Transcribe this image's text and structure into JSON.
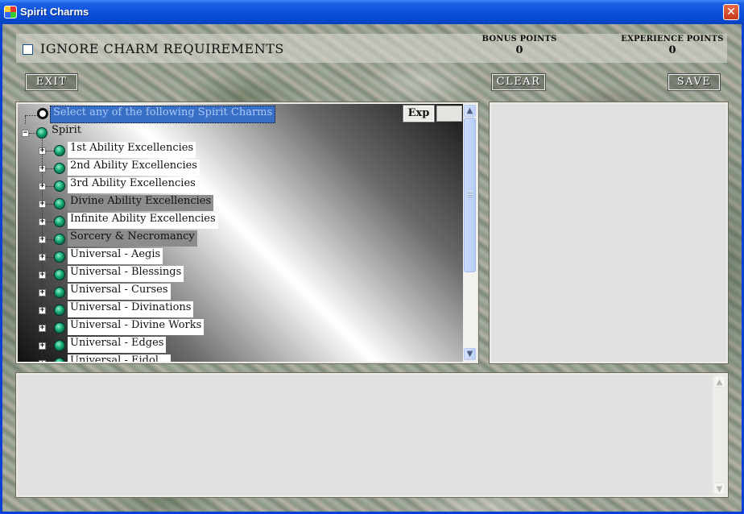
{
  "window": {
    "title": "Spirit Charms",
    "close_glyph": "✕"
  },
  "topbar": {
    "ignore_label": "Ignore Charm Requirements",
    "ignore_checked": false,
    "bonus_label": "Bonus Points",
    "bonus_value": "0",
    "xp_label": "Experience Points",
    "xp_value": "0"
  },
  "buttons": {
    "exit": "Exit",
    "clear": "Clear",
    "save": "Save"
  },
  "tree": {
    "header": "Select any of the following Spirit Charms",
    "exp_button": "Exp",
    "root": "Spirit",
    "items": [
      {
        "label": "1st Ability Excellencies",
        "style": "white"
      },
      {
        "label": "2nd Ability Excellencies",
        "style": "white"
      },
      {
        "label": "3rd Ability Excellencies",
        "style": "white"
      },
      {
        "label": "Divine Ability Excellencies",
        "style": "gray"
      },
      {
        "label": "Infinite Ability Excellencies",
        "style": "white"
      },
      {
        "label": "Sorcery & Necromancy",
        "style": "gray"
      },
      {
        "label": "Universal - Aegis",
        "style": "white"
      },
      {
        "label": "Universal - Blessings",
        "style": "white"
      },
      {
        "label": "Universal - Curses",
        "style": "white"
      },
      {
        "label": "Universal - Divinations",
        "style": "white"
      },
      {
        "label": "Universal - Divine Works",
        "style": "white"
      },
      {
        "label": "Universal - Edges",
        "style": "white"
      },
      {
        "label": "Universal - Eidol...",
        "style": "white"
      }
    ],
    "colors": {
      "selection": "#3a6fc6",
      "gem": "#12a56e"
    }
  }
}
